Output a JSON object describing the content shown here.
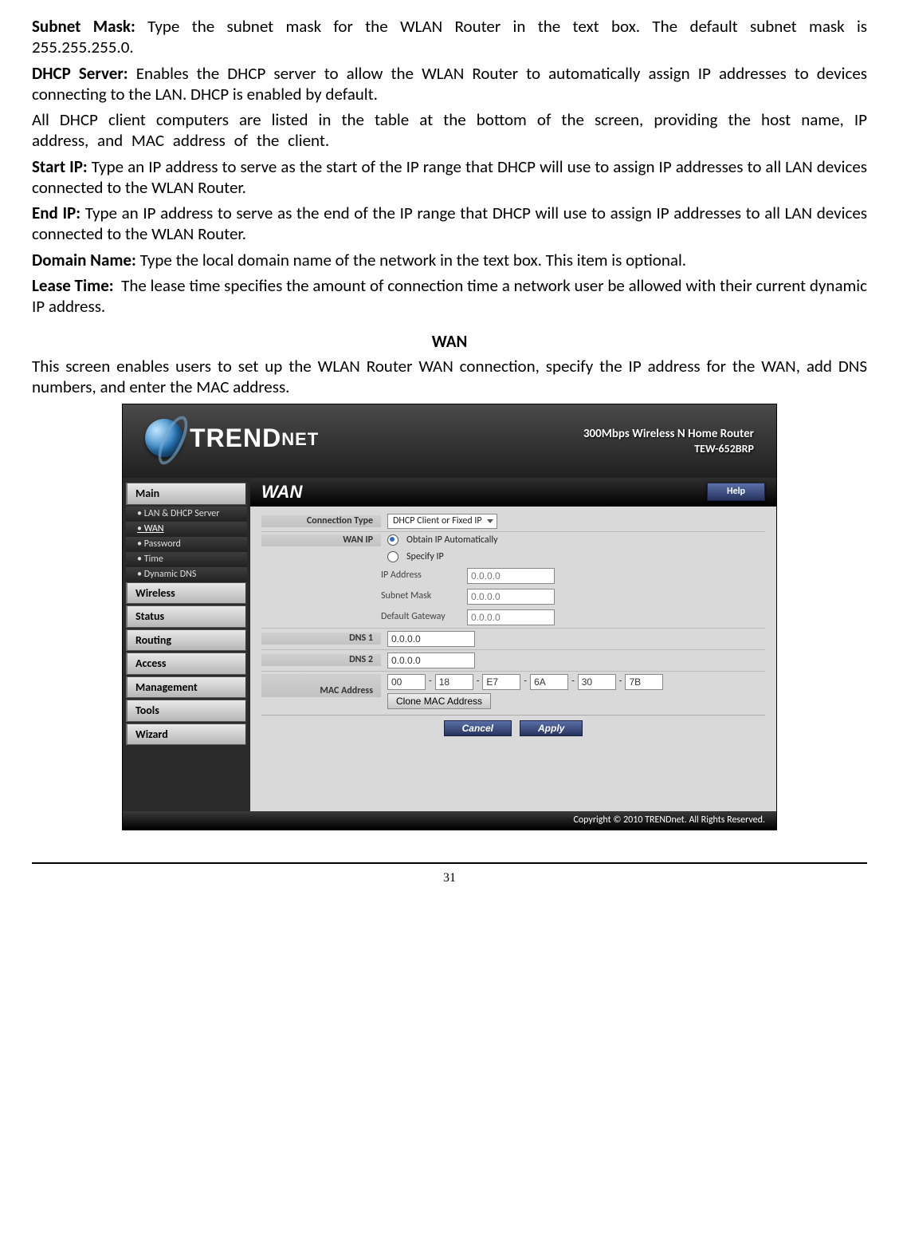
{
  "paragraphs": {
    "subnet_label": "Subnet Mask:",
    "subnet_text": "Type the subnet mask for the WLAN Router in the text box. The default subnet mask is 255.255.255.0.",
    "dhcp_label": "DHCP Server:",
    "dhcp_text": "Enables the DHCP server to allow the WLAN Router to automatically assign IP addresses to devices connecting to the LAN. DHCP is enabled by default.",
    "dhcp_note": "All DHCP client computers are listed in the table at the bottom of the screen, providing the host name, IP address, and MAC address of the client.",
    "startip_label": "Start IP:",
    "startip_text": "Type an IP address to serve as the start of the IP range that DHCP will use to assign IP addresses to all LAN devices connected to the WLAN Router.",
    "endip_label": "End IP:",
    "endip_text": "Type an IP address to serve as the end of the IP range that DHCP will use to assign IP addresses to all LAN devices connected to the WLAN Router.",
    "domain_label": "Domain Name:",
    "domain_text": "Type the local domain name of the network in the text box. This item is optional.",
    "lease_label": "Lease Time:",
    "lease_text": "The lease time specifies the amount of connection time a network user be allowed with their current dynamic IP address."
  },
  "section": {
    "wan_title": "WAN",
    "wan_intro": "This screen enables users to set up the WLAN Router WAN connection, specify the IP address for the WAN, add DNS numbers, and enter the MAC address."
  },
  "router": {
    "brand_text": "TRENDNET",
    "tagline_line1": "300Mbps Wireless N Home Router",
    "tagline_line2": "TEW-652BRP",
    "sidebar": {
      "main": "Main",
      "subs": [
        "LAN & DHCP Server",
        "WAN",
        "Password",
        "Time",
        "Dynamic DNS"
      ],
      "panels": [
        "Wireless",
        "Status",
        "Routing",
        "Access",
        "Management",
        "Tools",
        "Wizard"
      ]
    },
    "content": {
      "title": "WAN",
      "help": "Help",
      "labels": {
        "conn_type": "Connection Type",
        "wan_ip": "WAN IP",
        "ip_address": "IP Address",
        "subnet_mask": "Subnet Mask",
        "default_gw": "Default Gateway",
        "dns1": "DNS 1",
        "dns2": "DNS 2",
        "mac": "MAC Address"
      },
      "values": {
        "conn_type": "DHCP Client or Fixed IP",
        "obtain_auto": "Obtain IP Automatically",
        "specify_ip": "Specify IP",
        "ip_placeholder": "0.0.0.0",
        "dns_value": "0.0.0.0",
        "mac": [
          "00",
          "18",
          "E7",
          "6A",
          "30",
          "7B"
        ],
        "clone": "Clone MAC Address",
        "cancel": "Cancel",
        "apply": "Apply"
      }
    },
    "footer": "Copyright © 2010 TRENDnet. All Rights Reserved."
  },
  "page_number": "31"
}
